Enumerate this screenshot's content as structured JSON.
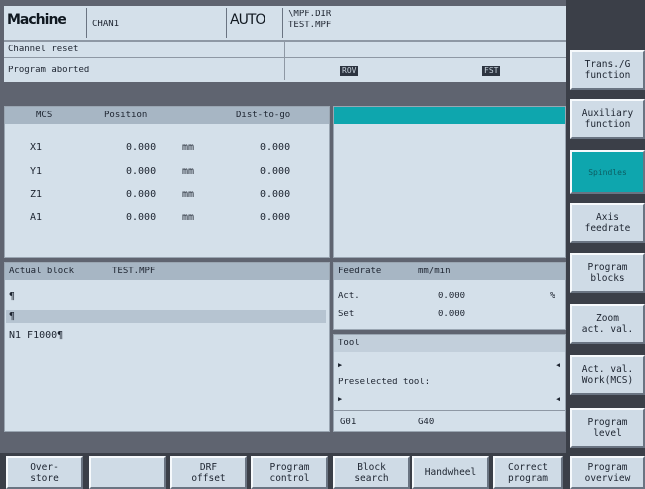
{
  "header": {
    "area": "Machine",
    "channel": "CHAN1",
    "mode": "AUTO",
    "path": "\\MPF.DIR",
    "program": "TEST.MPF",
    "status_1": "Channel reset",
    "status_2": "Program aborted",
    "flag_rov": "ROV",
    "flag_fst": "FST"
  },
  "position_table": {
    "headers": [
      "MCS",
      "Position",
      "Dist-to-go"
    ],
    "rows": [
      {
        "axis": "X1",
        "position": "0.000",
        "unit": "mm",
        "dist": "0.000"
      },
      {
        "axis": "Y1",
        "position": "0.000",
        "unit": "mm",
        "dist": "0.000"
      },
      {
        "axis": "Z1",
        "position": "0.000",
        "unit": "mm",
        "dist": "0.000"
      },
      {
        "axis": "A1",
        "position": "0.000",
        "unit": "mm",
        "dist": "0.000"
      }
    ]
  },
  "actual_block": {
    "title": "Actual block",
    "program": "TEST.MPF",
    "lines": [
      "¶",
      "¶",
      "N1 F1000¶"
    ]
  },
  "feedrate": {
    "title": "Feedrate",
    "unit": "mm/min",
    "act_label": "Act.",
    "act_value": "0.000",
    "act_unit": "%",
    "set_label": "Set",
    "set_value": "0.000"
  },
  "tool": {
    "title": "Tool",
    "preselected_label": "Preselected tool:",
    "gcode_1": "G01",
    "gcode_2": "G40"
  },
  "vertical_softkeys": [
    {
      "line1": "Trans./G",
      "line2": "function"
    },
    {
      "line1": "Auxiliary",
      "line2": "function"
    },
    {
      "line1": "Spindles",
      "line2": ""
    },
    {
      "line1": "Axis",
      "line2": "feedrate"
    },
    {
      "line1": "Program",
      "line2": "blocks"
    },
    {
      "line1": "Zoom",
      "line2": "act. val."
    },
    {
      "line1": "Act. val.",
      "line2": "Work(MCS)"
    },
    {
      "line1": "Program",
      "line2": "level"
    }
  ],
  "horizontal_softkeys": [
    {
      "line1": "Over-",
      "line2": "store"
    },
    {
      "line1": "",
      "line2": ""
    },
    {
      "line1": "DRF",
      "line2": "offset"
    },
    {
      "line1": "Program",
      "line2": "control"
    },
    {
      "line1": "Block",
      "line2": "search"
    },
    {
      "line1": "Handwheel",
      "line2": ""
    },
    {
      "line1": "Correct",
      "line2": "program"
    },
    {
      "line1": "Program",
      "line2": "overview"
    }
  ],
  "colors": {
    "accent": "#0ea6ae",
    "panel": "#d4e0ea",
    "header_bar": "#a7b6c4",
    "frame": "#5f6470"
  }
}
